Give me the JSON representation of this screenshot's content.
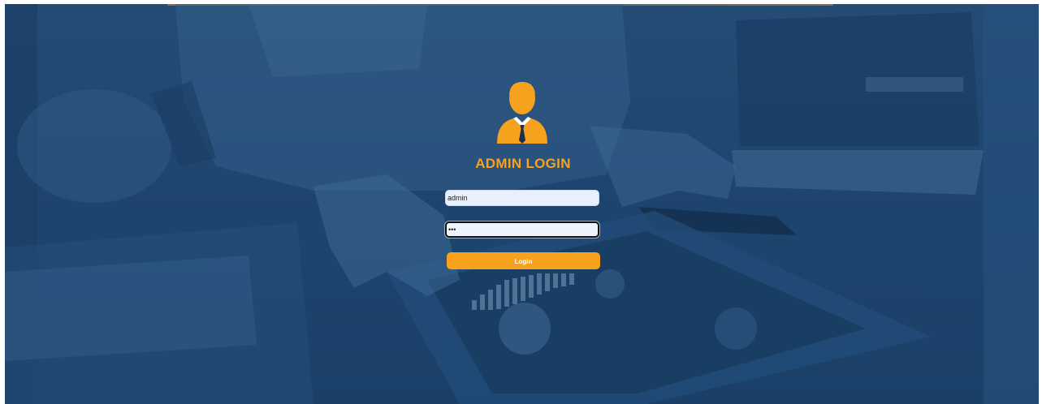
{
  "login": {
    "title": "ADMIN LOGIN",
    "avatar_icon": "admin-user-icon",
    "username_value": "admin",
    "password_value": "•••",
    "button_label": "Login"
  },
  "colors": {
    "accent": "#f6a21e",
    "overlay": "#1f4670",
    "button_text": "#ffffff"
  }
}
